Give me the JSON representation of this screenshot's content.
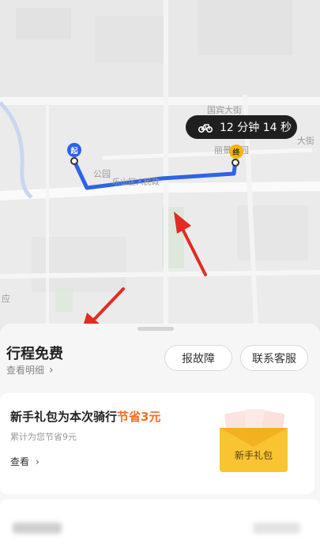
{
  "map": {
    "ride_time": "12 分钟 14 秒",
    "start_label": "起",
    "end_label": "终",
    "place_labels": {
      "road_top": "国宾大街",
      "right_street": "大街",
      "garden": "丽景花园",
      "park": "公园",
      "street_mid": "乐山区人民政",
      "left_edge": "应"
    }
  },
  "trip": {
    "title": "行程免费",
    "detail_link": "查看明细",
    "report_button": "报故障",
    "service_button": "联系客服"
  },
  "gift": {
    "headline_prefix": "新手礼包为本次骑行",
    "headline_highlight": "节省3元",
    "subtext": "累计为您节省9元",
    "view_link": "查看",
    "package_label": "新手礼包"
  },
  "colors": {
    "route": "#2e63e6",
    "highlight": "#ff6b1a",
    "start_pin": "#2e63e6",
    "end_pin": "#f7b500",
    "annotation_arrow": "#e22b22"
  }
}
